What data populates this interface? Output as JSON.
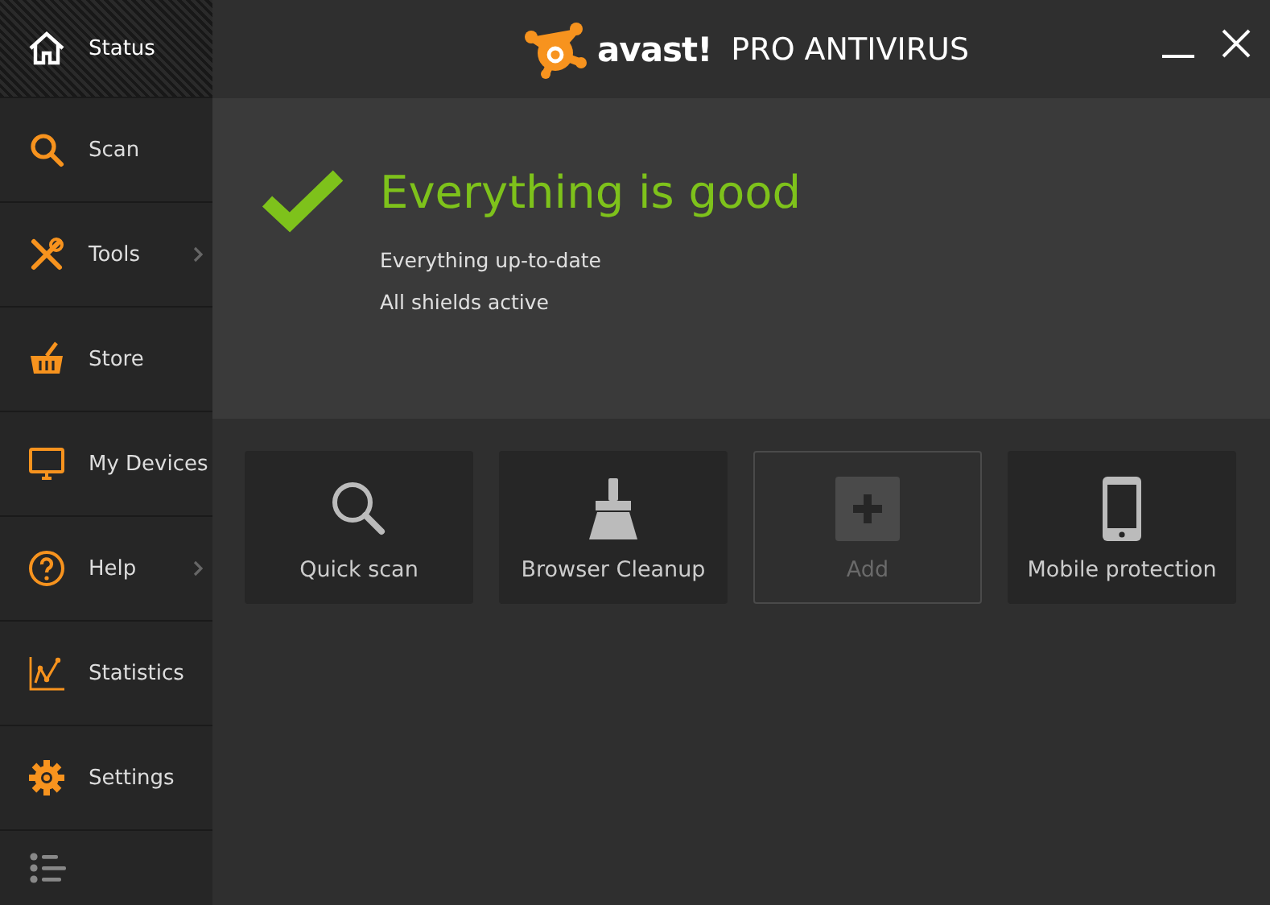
{
  "sidebar": {
    "items": [
      {
        "label": "Status",
        "kind": "home",
        "selected": true,
        "submenu": false
      },
      {
        "label": "Scan",
        "kind": "search",
        "selected": false,
        "submenu": false
      },
      {
        "label": "Tools",
        "kind": "tools",
        "selected": false,
        "submenu": true
      },
      {
        "label": "Store",
        "kind": "basket",
        "selected": false,
        "submenu": false
      },
      {
        "label": "My Devices",
        "kind": "monitor",
        "selected": false,
        "submenu": false
      },
      {
        "label": "Help",
        "kind": "help",
        "selected": false,
        "submenu": true
      },
      {
        "label": "Statistics",
        "kind": "chart",
        "selected": false,
        "submenu": false
      },
      {
        "label": "Settings",
        "kind": "gear",
        "selected": false,
        "submenu": false
      }
    ]
  },
  "header": {
    "logo": "avast!",
    "title": "PRO ANTIVIRUS"
  },
  "status": {
    "headline": "Everything is good",
    "details": [
      "Everything up-to-date",
      "All shields active"
    ]
  },
  "tiles": [
    {
      "label": "Quick scan",
      "kind": "search",
      "disabled": false
    },
    {
      "label": "Browser Cleanup",
      "kind": "broom",
      "disabled": false
    },
    {
      "label": "Add",
      "kind": "plus",
      "disabled": true
    },
    {
      "label": "Mobile protection",
      "kind": "phone",
      "disabled": false
    }
  ]
}
